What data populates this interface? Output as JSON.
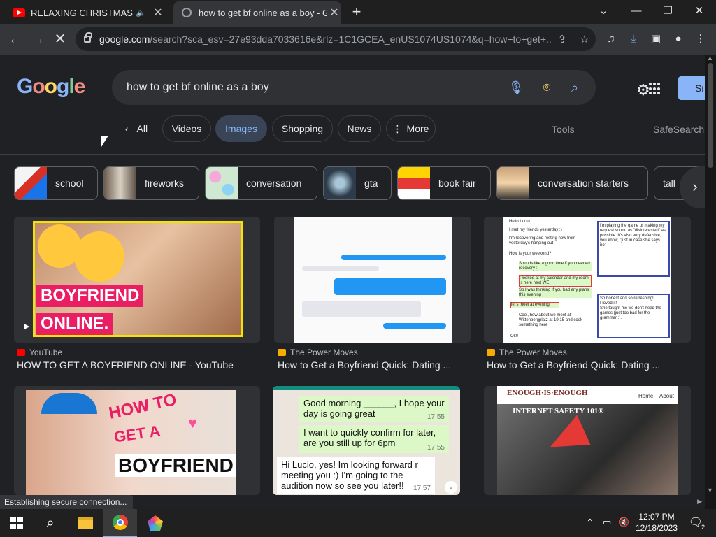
{
  "browser": {
    "tabs": [
      {
        "title": "RELAXING CHRISTMAS MUS",
        "favicon": "youtube-icon"
      },
      {
        "title": "how to get bf online as a boy - G",
        "favicon": "loading-icon"
      }
    ],
    "url_host": "google.com",
    "url_rest": "/search?sca_esv=27e93dda7033616e&rlz=1C1GCEA_enUS1074US1074&q=how+to+get+..."
  },
  "google": {
    "logo": "Google",
    "query": "how to get bf online as a boy",
    "sign_in": "Si"
  },
  "filters": {
    "back_all": "All",
    "items": [
      "Videos",
      "Images",
      "Shopping",
      "News",
      "More"
    ],
    "tools": "Tools",
    "safesearch": "SafeSearch"
  },
  "chips": [
    "school",
    "fireworks",
    "conversation",
    "gta",
    "book fair",
    "conversation starters",
    "tall"
  ],
  "results": [
    {
      "source": "YouTube",
      "caption": "HOW TO GET A BOYFRIEND ONLINE - YouTube",
      "img_text": [
        "BOYFRIEND",
        "ONLINE."
      ]
    },
    {
      "source": "The Power Moves",
      "caption": "How to Get a Boyfriend Quick: Dating ..."
    },
    {
      "source": "The Power Moves",
      "caption": "How to Get a Boyfriend Quick: Dating ...",
      "chat": [
        "Hello Lucio",
        "I met my friends yesterday :)",
        "I'm recovering and resting now from yesterday's hanging out",
        "How is your weekend?",
        "Sounds like a good time if you needed recovery :)",
        "I looked at my calendar and my room is here next WE",
        "So I was thinking if you had any plans this evening",
        "let's meet at evening!",
        "Cool, how about we meet at Wittenbergplatz at 19:15 and cook something here",
        "Ok!!",
        "I'm playing the game of making my request sound as \"disinterested\" as possible.",
        "It's also very defensive, you know, \"just in case she says no\"",
        "So honest and so refreshing!",
        "I loved it!",
        "She taught me we don't need the games (just too bad for the grammar :)."
      ]
    },
    {
      "img_text": [
        "HOW TO",
        "GET A",
        "BOYFRIEND"
      ]
    },
    {
      "chat": [
        "Good morning ______, I hope your day is going great",
        "I want to quickly confirm for later, are you still up for 6pm",
        "Hi Lucio, yes! Im looking forward r meeting you :) I'm going to the audition now so see you later!!"
      ],
      "times": [
        "17:55",
        "17:55",
        "17:57"
      ]
    },
    {
      "brand": "ENOUGH·IS·ENOUGH",
      "nav": [
        "Home",
        "About"
      ],
      "banner": "INTERNET SAFETY 101®"
    }
  ],
  "status": "Establishing secure connection...",
  "taskbar": {
    "time": "12:07 PM",
    "date": "12/18/2023",
    "notifications": "2"
  },
  "colors": {
    "accent": "#8ab4f8",
    "active_filter_bg": "#394457",
    "page_bg": "#202124"
  }
}
